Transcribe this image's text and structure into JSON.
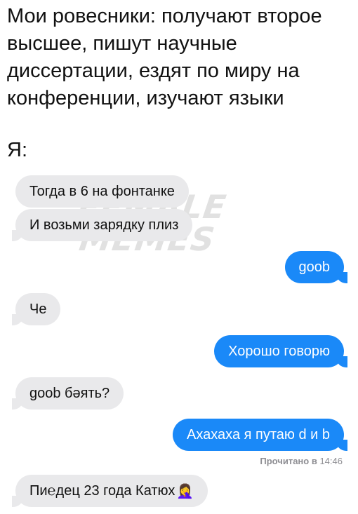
{
  "caption": "Мои ровесники: получают второе\nвысшее, пишут научные\nдиссертации, ездят по миру на\nконференции, изучают языки",
  "me_label": "Я:",
  "watermark": {
    "line1": "FEMALE",
    "line2": "MEMES"
  },
  "messages": [
    {
      "side": "in",
      "text": "Тогда в 6 на фонтанке"
    },
    {
      "side": "in",
      "text": "И возьми зарядку плиз"
    },
    {
      "side": "out",
      "text": "goob"
    },
    {
      "side": "in",
      "text": "Че"
    },
    {
      "side": "out",
      "text": "Хорошо говорю"
    },
    {
      "side": "in",
      "text": "goob бəять?"
    },
    {
      "side": "out",
      "text": "Ахахаха я путаю d и b"
    },
    {
      "side": "in",
      "text": "Пи℮дец 23 года Катюх",
      "emoji": "🤦‍♀️",
      "emoji_name": "woman-facepalming-icon"
    }
  ],
  "read_receipt": {
    "label": "Прочитано в",
    "time": "14:46"
  },
  "colors": {
    "incoming_bubble": "#e9e9eb",
    "outgoing_bubble": "#1a89f8",
    "receipt_text": "#8e8e93"
  }
}
